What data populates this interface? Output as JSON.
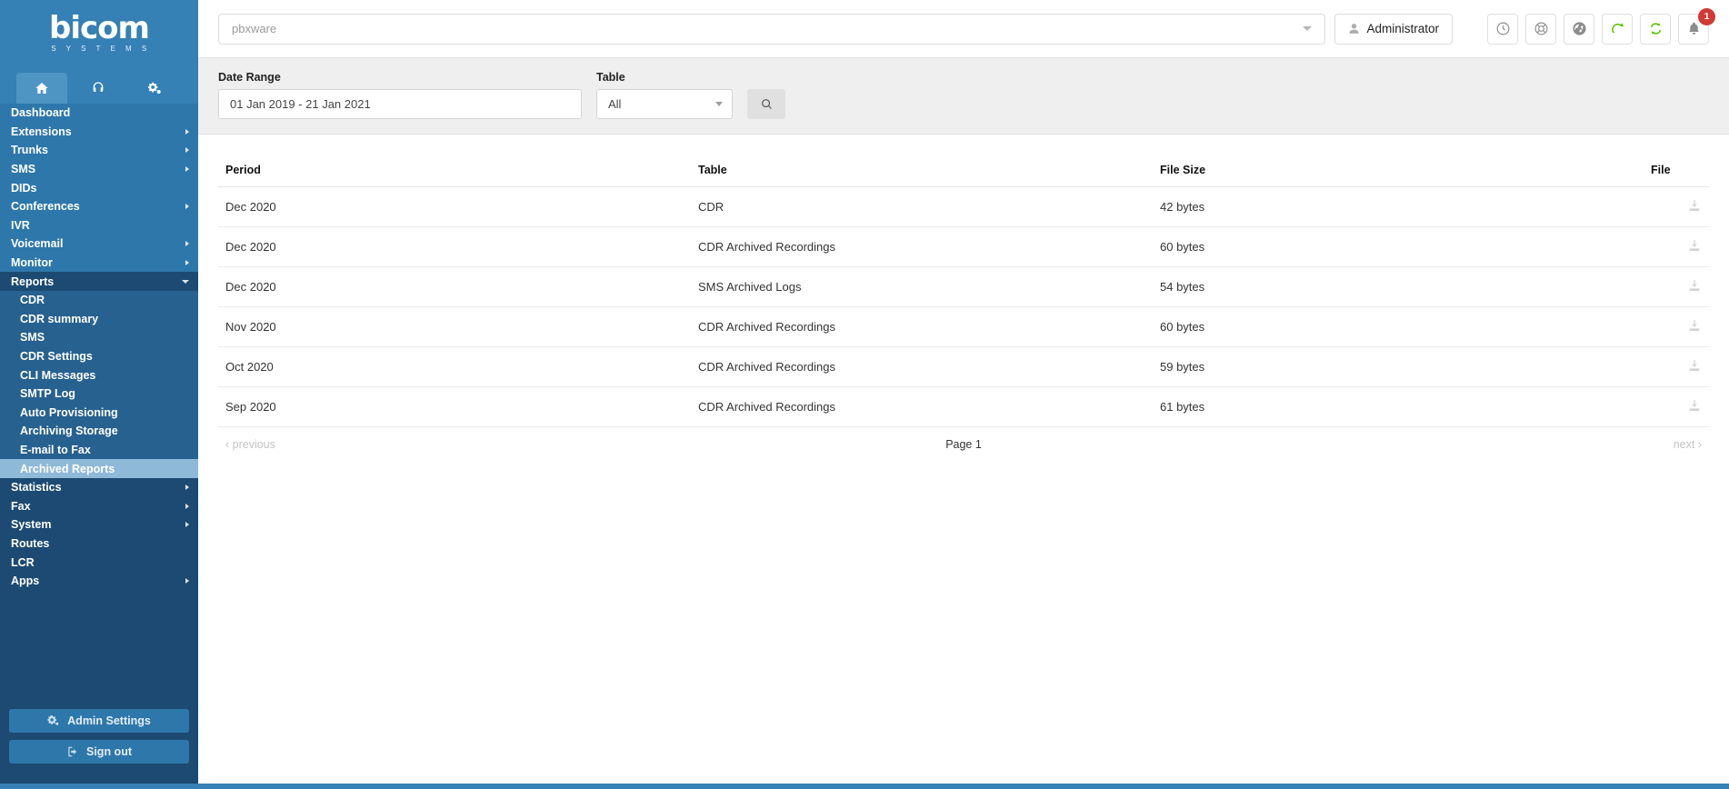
{
  "brand": {
    "name": "bicom",
    "tagline": "S Y S T E M S"
  },
  "tabs": [
    {
      "name": "home-tab",
      "icon": "home-icon",
      "active": true
    },
    {
      "name": "support-tab",
      "icon": "headset-icon",
      "active": false
    },
    {
      "name": "settings-tab",
      "icon": "gears-icon",
      "active": false
    }
  ],
  "sidebar": {
    "items": [
      {
        "label": "Dashboard",
        "level": 0,
        "caret": "none",
        "state": "normal"
      },
      {
        "label": "Extensions",
        "level": 0,
        "caret": "right",
        "state": "normal"
      },
      {
        "label": "Trunks",
        "level": 0,
        "caret": "right",
        "state": "normal"
      },
      {
        "label": "SMS",
        "level": 0,
        "caret": "right",
        "state": "normal"
      },
      {
        "label": "DIDs",
        "level": 0,
        "caret": "none",
        "state": "normal"
      },
      {
        "label": "Conferences",
        "level": 0,
        "caret": "right",
        "state": "normal"
      },
      {
        "label": "IVR",
        "level": 0,
        "caret": "none",
        "state": "normal"
      },
      {
        "label": "Voicemail",
        "level": 0,
        "caret": "right",
        "state": "normal"
      },
      {
        "label": "Monitor",
        "level": 0,
        "caret": "right",
        "state": "normal"
      },
      {
        "label": "Reports",
        "level": 0,
        "caret": "down",
        "state": "open"
      },
      {
        "label": "CDR",
        "level": 1,
        "caret": "none",
        "state": "normal"
      },
      {
        "label": "CDR summary",
        "level": 1,
        "caret": "none",
        "state": "normal"
      },
      {
        "label": "SMS",
        "level": 1,
        "caret": "none",
        "state": "normal"
      },
      {
        "label": "CDR Settings",
        "level": 1,
        "caret": "none",
        "state": "normal"
      },
      {
        "label": "CLI Messages",
        "level": 1,
        "caret": "none",
        "state": "normal"
      },
      {
        "label": "SMTP Log",
        "level": 1,
        "caret": "none",
        "state": "normal"
      },
      {
        "label": "Auto Provisioning",
        "level": 1,
        "caret": "none",
        "state": "normal"
      },
      {
        "label": "Archiving Storage",
        "level": 1,
        "caret": "none",
        "state": "normal"
      },
      {
        "label": "E-mail to Fax",
        "level": 1,
        "caret": "none",
        "state": "normal"
      },
      {
        "label": "Archived Reports",
        "level": 1,
        "caret": "none",
        "state": "active"
      },
      {
        "label": "Statistics",
        "level": 0,
        "caret": "right",
        "state": "below"
      },
      {
        "label": "Fax",
        "level": 0,
        "caret": "right",
        "state": "below"
      },
      {
        "label": "System",
        "level": 0,
        "caret": "right",
        "state": "below"
      },
      {
        "label": "Routes",
        "level": 0,
        "caret": "none",
        "state": "below"
      },
      {
        "label": "LCR",
        "level": 0,
        "caret": "none",
        "state": "below"
      },
      {
        "label": "Apps",
        "level": 0,
        "caret": "right",
        "state": "below"
      }
    ],
    "admin_settings_label": "Admin Settings",
    "sign_out_label": "Sign out"
  },
  "topbar": {
    "server_placeholder": "pbxware",
    "admin_label": "Administrator",
    "icons": [
      {
        "name": "clock-icon",
        "badge": null
      },
      {
        "name": "lifebuoy-icon",
        "badge": null
      },
      {
        "name": "globe-icon",
        "badge": null
      },
      {
        "name": "refresh-icon",
        "badge": null
      },
      {
        "name": "sync-icon",
        "badge": null
      },
      {
        "name": "bell-icon",
        "badge": "1"
      }
    ]
  },
  "filters": {
    "date_range_label": "Date Range",
    "date_range_value": "01 Jan 2019 - 21 Jan 2021",
    "table_label": "Table",
    "table_value": "All"
  },
  "table": {
    "headers": [
      "Period",
      "Table",
      "File Size",
      "File"
    ],
    "rows": [
      {
        "period": "Dec 2020",
        "table": "CDR",
        "size": "42 bytes",
        "file_icon": "download-icon"
      },
      {
        "period": "Dec 2020",
        "table": "CDR Archived Recordings",
        "size": "60 bytes",
        "file_icon": "download-icon"
      },
      {
        "period": "Dec 2020",
        "table": "SMS Archived Logs",
        "size": "54 bytes",
        "file_icon": "download-icon"
      },
      {
        "period": "Nov 2020",
        "table": "CDR Archived Recordings",
        "size": "60 bytes",
        "file_icon": "download-icon"
      },
      {
        "period": "Oct 2020",
        "table": "CDR Archived Recordings",
        "size": "59 bytes",
        "file_icon": "download-icon"
      },
      {
        "period": "Sep 2020",
        "table": "CDR Archived Recordings",
        "size": "61 bytes",
        "file_icon": "download-icon"
      }
    ]
  },
  "pagination": {
    "previous_label": "‹ previous",
    "page_label": "Page 1",
    "next_label": "next ›"
  },
  "colors": {
    "sidebar_dark": "#1c4a72",
    "sidebar_mid": "#2e77ab",
    "sidebar_brand": "#3580b5",
    "active_item": "#8fb9d8",
    "badge_red": "#d23a34",
    "green_accent": "#5cc000"
  }
}
